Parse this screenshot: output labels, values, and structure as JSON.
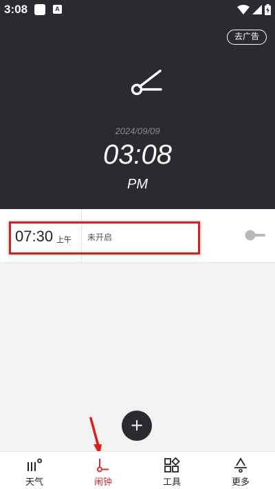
{
  "status_bar": {
    "time": "3:08",
    "app2_glyph": "A"
  },
  "header": {
    "ad_button": "去广告",
    "clock_icon": "alarm-hand-icon",
    "date": "2024/09/09",
    "time": "03:08",
    "ampm": "PM"
  },
  "alarm": {
    "time": "07:30",
    "ampm": "上午",
    "status": "未开启",
    "enabled": false
  },
  "fab": {
    "label": "+"
  },
  "nav": {
    "items": [
      {
        "label": "天气",
        "icon": "weather-icon"
      },
      {
        "label": "闹钟",
        "icon": "alarm-icon"
      },
      {
        "label": "工具",
        "icon": "tools-icon"
      },
      {
        "label": "更多",
        "icon": "more-icon"
      }
    ],
    "active": "闹钟"
  },
  "colors": {
    "header_bg": "#2b2b2f",
    "accent": "#e02b2b",
    "highlight": "#e21b1b"
  }
}
